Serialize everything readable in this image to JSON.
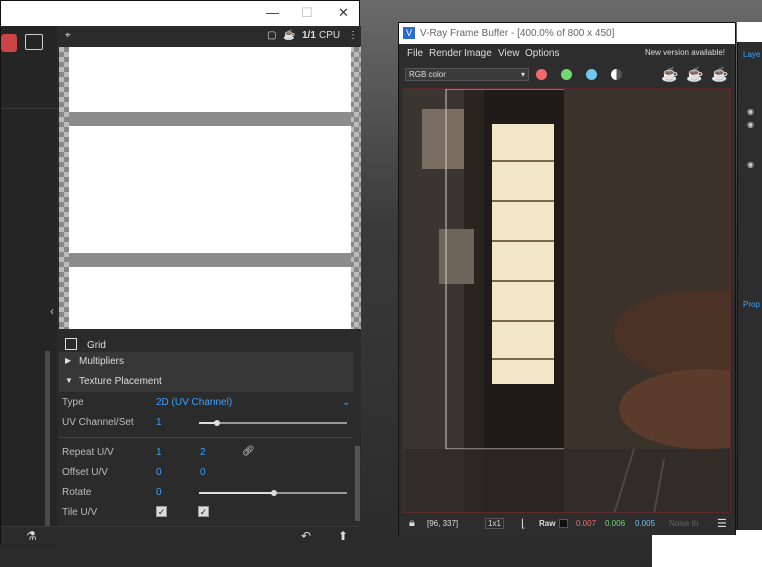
{
  "left_window": {
    "title_controls": {
      "minimize": "—",
      "maximize": "☐",
      "close": "✕"
    },
    "preview_toolbar": {
      "cpu_label": "CPU",
      "ratio_label": "1/1"
    },
    "panel": {
      "header_label": "Grid",
      "sections": {
        "multipliers": "Multipliers",
        "texture_placement": "Texture Placement"
      },
      "rows": {
        "type": {
          "label": "Type",
          "value": "2D (UV Channel)"
        },
        "uv_channel": {
          "label": "UV Channel/Set",
          "value": "1"
        },
        "repeat": {
          "label": "Repeat U/V",
          "u": "1",
          "v": "2"
        },
        "offset": {
          "label": "Offset U/V",
          "u": "0",
          "v": "0"
        },
        "rotate": {
          "label": "Rotate",
          "value": "0"
        },
        "tile": {
          "label": "Tile U/V"
        }
      }
    }
  },
  "vfb": {
    "title": "V-Ray Frame Buffer - [400.0% of 800 x 450]",
    "menu": [
      "File",
      "Render",
      "Image",
      "View",
      "Options"
    ],
    "new_version": "New version available!",
    "channel_select": "RGB color",
    "status": {
      "coords": "[96, 337]",
      "zoom": "1x1",
      "raw": "Raw",
      "r": "0.007",
      "g": "0.006",
      "b": "0.005",
      "noise": "Noise th"
    },
    "colors": {
      "red_dot": "#ef6b6b",
      "green_dot": "#6fd96f",
      "blue_dot": "#6fc6ef"
    }
  },
  "right_panel": {
    "layers_label": "Laye",
    "props_label": "Prop"
  }
}
